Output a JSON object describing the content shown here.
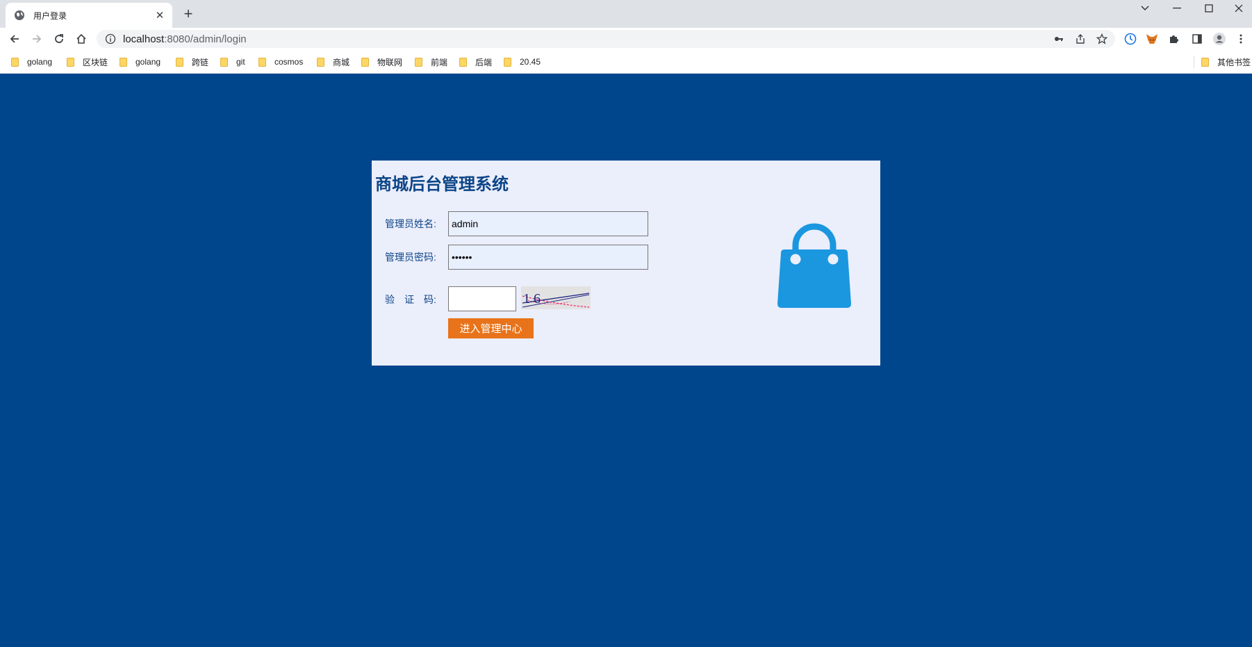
{
  "browser": {
    "tab_title": "用户登录",
    "url_host": "localhost",
    "url_path": ":8080/admin/login",
    "bookmarks": [
      "golang",
      "区块链",
      "golang",
      "跨链",
      "git",
      "cosmos",
      "商城",
      "物联网",
      "前端",
      "后端",
      "20.45"
    ],
    "other_bookmarks": "其他书签"
  },
  "login": {
    "system_title": "商城后台管理系统",
    "username_label": "管理员姓名:",
    "username_value": "admin",
    "password_label": "管理员密码:",
    "password_value": "••••••",
    "captcha_label": "验　证　码:",
    "captcha_value": "",
    "captcha_text": "1 6",
    "submit_label": "进入管理中心"
  },
  "icons": {
    "tab": "globe-icon",
    "bag": "shopping-bag-icon"
  },
  "colors": {
    "page_bg": "#00468c",
    "panel_bg": "#ebeefb",
    "title": "#0c4587",
    "button": "#e8731a",
    "bag": "#1a97df"
  }
}
